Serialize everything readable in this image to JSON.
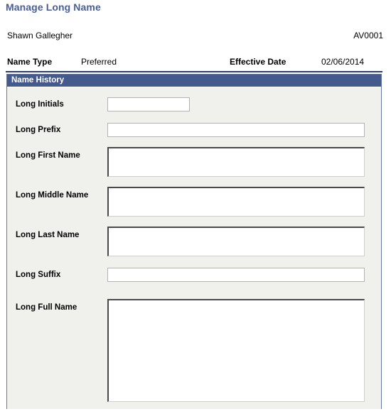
{
  "page": {
    "title": "Manage Long Name"
  },
  "identity": {
    "person_name": "Shawn Gallegher",
    "person_id": "AV0001"
  },
  "meta": {
    "name_type_label": "Name Type",
    "name_type_value": "Preferred",
    "effective_date_label": "Effective Date",
    "effective_date_value": "02/06/2014"
  },
  "group": {
    "header": "Name History"
  },
  "fields": [
    {
      "label": "Long Initials",
      "value": "",
      "placeholder": ""
    },
    {
      "label": "Long Prefix",
      "value": "",
      "placeholder": ""
    },
    {
      "label": "Long First Name",
      "value": "",
      "placeholder": ""
    },
    {
      "label": "Long Middle Name",
      "value": "",
      "placeholder": ""
    },
    {
      "label": "Long Last Name",
      "value": "",
      "placeholder": ""
    },
    {
      "label": "Long Suffix",
      "value": "",
      "placeholder": ""
    },
    {
      "label": "Long Full Name",
      "value": "",
      "placeholder": ""
    }
  ],
  "colors": {
    "title_blue": "#4a5e96",
    "header_bar": "#455a8c",
    "rule": "#2c3e6b",
    "panel_bg": "#f0f0ec",
    "panel_border": "#6878a6"
  }
}
